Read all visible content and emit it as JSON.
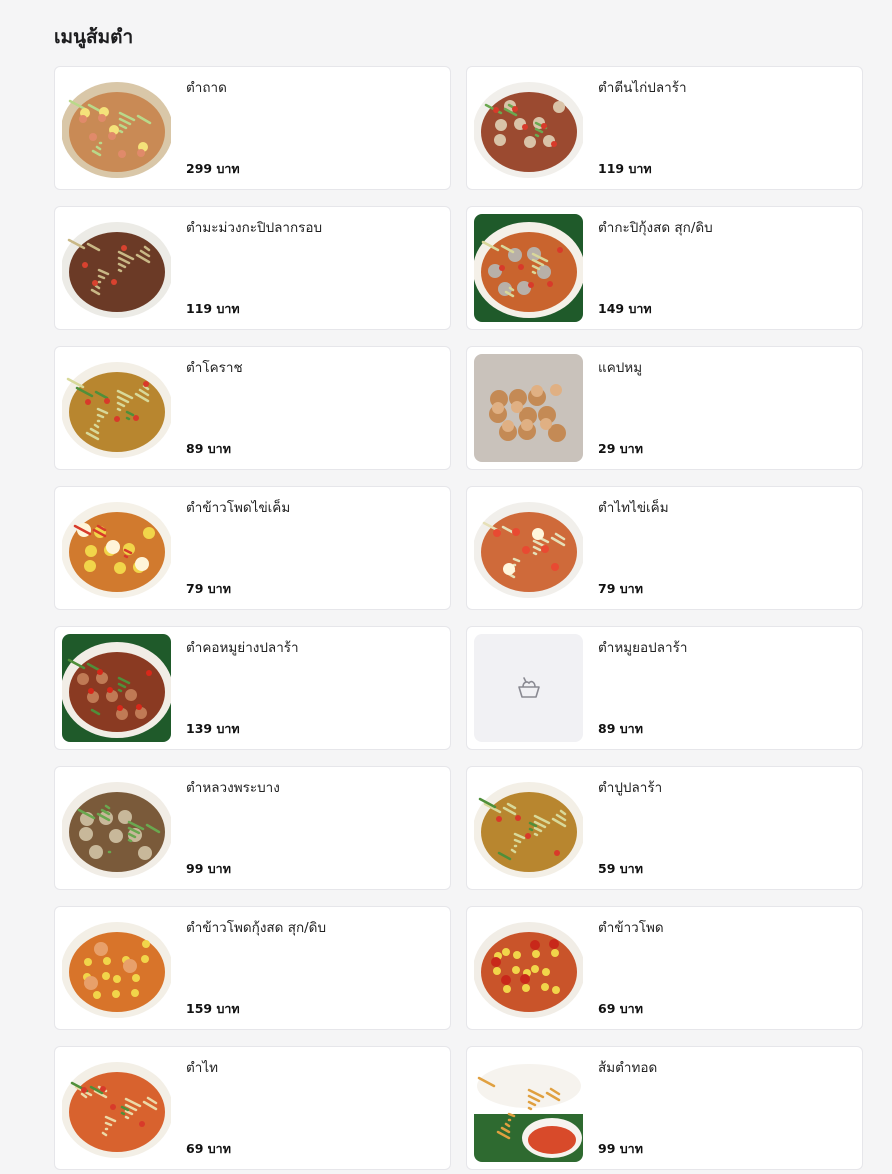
{
  "section": {
    "title": "เมนูส้มตำ"
  },
  "items": [
    {
      "name": "ตำถาด",
      "price": "299 บาท",
      "image": "tray-platter",
      "thumb_icon": ""
    },
    {
      "name": "ตำตีนไก่ปลาร้า",
      "price": "119 บาท",
      "image": "chicken-feet-salad",
      "thumb_icon": ""
    },
    {
      "name": "ตำมะม่วงกะปิปลากรอบ",
      "price": "119 บาท",
      "image": "mango-salad",
      "thumb_icon": ""
    },
    {
      "name": "ตำกะปิกุ้งสด สุก/ดิบ",
      "price": "149 บาท",
      "image": "shrimp-salad",
      "thumb_icon": ""
    },
    {
      "name": "ตำโคราช",
      "price": "89 บาท",
      "image": "papaya-salad",
      "thumb_icon": ""
    },
    {
      "name": "แคปหมู",
      "price": "29 บาท",
      "image": "pork-cracklings",
      "thumb_icon": ""
    },
    {
      "name": "ตำข้าวโพดไข่เค็ม",
      "price": "79 บาท",
      "image": "corn-salted-egg",
      "thumb_icon": ""
    },
    {
      "name": "ตำไทไข่เค็ม",
      "price": "79 บาท",
      "image": "thai-salted-egg",
      "thumb_icon": ""
    },
    {
      "name": "ตำคอหมูย่างปลาร้า",
      "price": "139 บาท",
      "image": "grilled-pork-neck",
      "thumb_icon": ""
    },
    {
      "name": "ตำหมูยอปลาร้า",
      "price": "89 บาท",
      "image": "placeholder",
      "thumb_icon": "salad-bowl-icon"
    },
    {
      "name": "ตำหลวงพระบาง",
      "price": "99 บาท",
      "image": "luang-prabang",
      "thumb_icon": ""
    },
    {
      "name": "ตำปูปลาร้า",
      "price": "59 บาท",
      "image": "crab-salad",
      "thumb_icon": ""
    },
    {
      "name": "ตำข้าวโพดกุ้งสด สุก/ดิบ",
      "price": "159 บาท",
      "image": "corn-shrimp",
      "thumb_icon": ""
    },
    {
      "name": "ตำข้าวโพด",
      "price": "69 บาท",
      "image": "corn-salad",
      "thumb_icon": ""
    },
    {
      "name": "ตำไท",
      "price": "69 บาท",
      "image": "thai-salad",
      "thumb_icon": ""
    },
    {
      "name": "ส้มตำทอด",
      "price": "99 บาท",
      "image": "fried-papaya",
      "thumb_icon": ""
    }
  ],
  "colors": {
    "background": "#f5f5f6",
    "card": "#ffffff",
    "card_border": "#e6e6ea",
    "placeholder": "#f1f1f4"
  }
}
